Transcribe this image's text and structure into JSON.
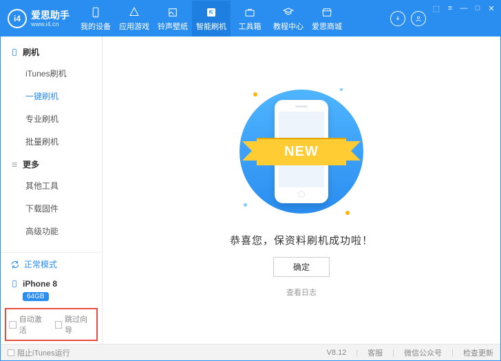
{
  "brand": {
    "name": "爱思助手",
    "url": "www.i4.cn",
    "logo_text": "i4"
  },
  "window_controls": {
    "skin": "⬚",
    "menu": "≡",
    "min": "—",
    "max": "□",
    "close": "✕"
  },
  "top_tabs": [
    {
      "id": "device",
      "label": "我的设备",
      "active": false
    },
    {
      "id": "apps",
      "label": "应用游戏",
      "active": false
    },
    {
      "id": "ring",
      "label": "铃声壁纸",
      "active": false
    },
    {
      "id": "flash",
      "label": "智能刷机",
      "active": true
    },
    {
      "id": "toolbox",
      "label": "工具箱",
      "active": false
    },
    {
      "id": "tutorial",
      "label": "教程中心",
      "active": false
    },
    {
      "id": "store",
      "label": "爱思商城",
      "active": false
    }
  ],
  "sidebar": {
    "section_flash": "刷机",
    "section_more": "更多",
    "flash_items": [
      {
        "id": "itunes",
        "label": "iTunes刷机",
        "active": false
      },
      {
        "id": "oneclick",
        "label": "一键刷机",
        "active": true
      },
      {
        "id": "pro",
        "label": "专业刷机",
        "active": false
      },
      {
        "id": "batch",
        "label": "批量刷机",
        "active": false
      }
    ],
    "more_items": [
      {
        "id": "other",
        "label": "其他工具"
      },
      {
        "id": "firmware",
        "label": "下载固件"
      },
      {
        "id": "adv",
        "label": "高级功能"
      }
    ],
    "mode": "正常模式",
    "device": {
      "name": "iPhone 8",
      "capacity": "64GB"
    },
    "options": {
      "auto_activate": "自动激活",
      "skip_guide": "跳过向导"
    }
  },
  "main": {
    "ribbon": "NEW",
    "success": "恭喜您，保资料刷机成功啦！",
    "ok": "确定",
    "view_log": "查看日志"
  },
  "footer": {
    "block_itunes": "阻止iTunes运行",
    "version": "V8.12",
    "support": "客服",
    "wechat": "微信公众号",
    "update": "检查更新"
  }
}
